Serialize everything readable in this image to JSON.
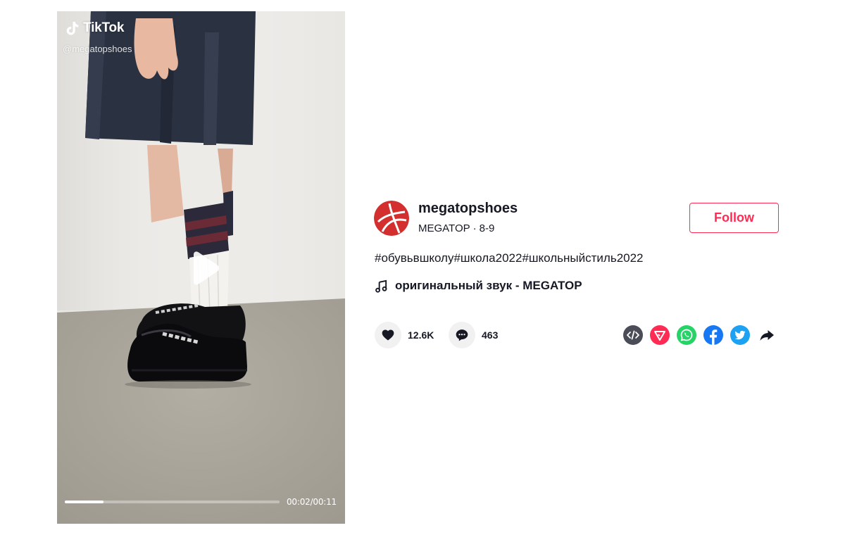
{
  "video": {
    "watermark_brand": "TikTok",
    "watermark_handle": "@megatopshoes",
    "progress_fraction": 0.18,
    "time_display": "00:02/00:11"
  },
  "author": {
    "username": "megatopshoes",
    "nickname": "MEGATOP",
    "date": "8-9",
    "separator": "·",
    "avatar_color": "#d32f2f"
  },
  "follow_label": "Follow",
  "description": "#обувьвшколу#школа2022#школьныйстиль2022",
  "sound": "оригинальный звук - MEGATOP",
  "stats": {
    "likes": "12.6K",
    "comments": "463"
  },
  "share_icons": [
    "embed-icon",
    "send-to-friends-icon",
    "whatsapp-icon",
    "facebook-icon",
    "twitter-icon",
    "share-arrow-icon"
  ],
  "colors": {
    "accent": "#fe2c55",
    "embed": "#4a4d57",
    "send": "#fe2c55",
    "whatsapp": "#25d366",
    "facebook": "#1877f2",
    "twitter": "#1da1f2"
  }
}
